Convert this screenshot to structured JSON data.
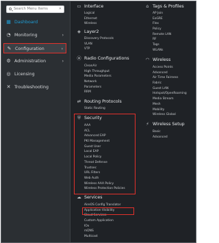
{
  "sidebar": {
    "search_placeholder": "Search Menu Items",
    "items": [
      {
        "label": "Dashboard",
        "icon": "dashboard-icon",
        "glyph": "▦"
      },
      {
        "label": "Monitoring",
        "icon": "monitoring-icon",
        "glyph": "◔",
        "chevron": "›"
      },
      {
        "label": "Configuration",
        "icon": "wrench-icon",
        "glyph": "✎",
        "chevron": "›"
      },
      {
        "label": "Administration",
        "icon": "gear-icon",
        "glyph": "⚙",
        "chevron": "›"
      },
      {
        "label": "Licensing",
        "icon": "licensing-icon",
        "glyph": "◎"
      },
      {
        "label": "Troubleshooting",
        "icon": "tools-icon",
        "glyph": "✕"
      }
    ]
  },
  "menu": {
    "interface": {
      "title": "Interface",
      "items": [
        "Logical",
        "Ethernet",
        "Wireless"
      ]
    },
    "layer2": {
      "title": "Layer2",
      "items": [
        "Discovery Protocols",
        "VLAN",
        "VTP"
      ]
    },
    "radio": {
      "title": "Radio Configurations",
      "items": [
        "CleanAir",
        "High Throughput",
        "Media Parameters",
        "Network",
        "Parameters",
        "RRM"
      ]
    },
    "routing": {
      "title": "Routing Protocols",
      "items": [
        "Static Routing"
      ]
    },
    "security": {
      "title": "Security",
      "items": [
        "AAA",
        "ACL",
        "Advanced EAP",
        "PKI Management",
        "Guest User",
        "Local EAP",
        "Local Policy",
        "Threat Defense",
        "Trustsec",
        "URL Filters",
        "Web Auth",
        "Wireless AAA Policy",
        "Wireless Protection Policies"
      ]
    },
    "services": {
      "title": "Services",
      "items": [
        "AireOS Config Translator",
        "Application Visibility",
        "Cloud Services",
        "Custom Application",
        "IOx",
        "mDNS",
        "Multicast"
      ]
    },
    "tags": {
      "title": "Tags & Profiles",
      "items": [
        "AP Join",
        "EoGRE",
        "Flex",
        "Policy",
        "Remote LAN",
        "RF",
        "Tags",
        "WLANs"
      ]
    },
    "wireless": {
      "title": "Wireless",
      "items": [
        "Access Points",
        "Advanced",
        "Air Time Fairness",
        "Fabric",
        "Guest LAN",
        "Hotspot/OpenRoaming",
        "Media Stream",
        "Mesh",
        "Mobility",
        "Wireless Global"
      ]
    },
    "wsetup": {
      "title": "Wireless Setup",
      "items": [
        "Basic",
        "Advanced"
      ]
    }
  },
  "colors": {
    "accent": "#1e9fd8",
    "highlight": "#e4312b"
  }
}
